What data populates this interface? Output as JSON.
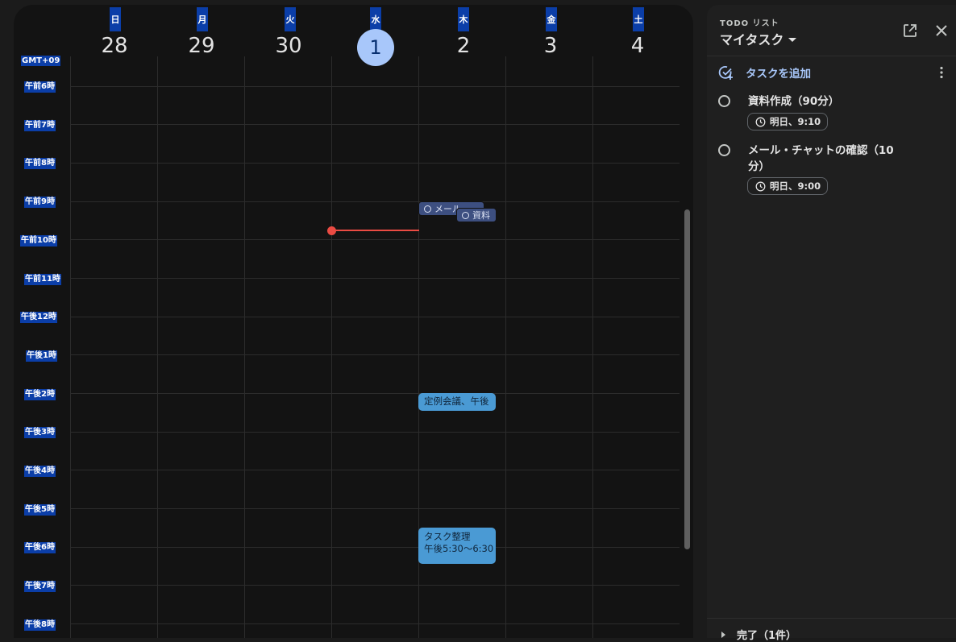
{
  "calendar": {
    "timezone": "GMT+09",
    "days": [
      {
        "abbr": "日",
        "date": "28"
      },
      {
        "abbr": "月",
        "date": "29"
      },
      {
        "abbr": "火",
        "date": "30"
      },
      {
        "abbr": "水",
        "date": "1",
        "today": true
      },
      {
        "abbr": "木",
        "date": "2"
      },
      {
        "abbr": "金",
        "date": "3"
      },
      {
        "abbr": "土",
        "date": "4"
      }
    ],
    "hours": [
      "午前6時",
      "午前7時",
      "午前8時",
      "午前9時",
      "午前10時",
      "午前11時",
      "午後12時",
      "午後1時",
      "午後2時",
      "午後3時",
      "午後4時",
      "午後5時",
      "午後6時",
      "午後7時",
      "午後8時"
    ],
    "task_chips": [
      {
        "label": "メール・",
        "day": "木"
      },
      {
        "label": "資料",
        "day": "木"
      }
    ],
    "events": [
      {
        "title": "定例会議、午後",
        "day": "木"
      },
      {
        "title": "タスク整理",
        "time": "午後5:30〜6:30",
        "day": "木"
      }
    ],
    "current_time_color": "#ea4b43",
    "event_color": "#4a9ad4"
  },
  "tasks_panel": {
    "caption": "TODO リスト",
    "list_title": "マイタスク",
    "add_task_label": "タスクを追加",
    "items": [
      {
        "title": "資料作成（90分）",
        "due": "明日、9:10"
      },
      {
        "title": "メール・チャットの確認（10分）",
        "due": "明日、9:00"
      }
    ],
    "completed_label": "完了（1件）",
    "accent": "#a8c7fa"
  }
}
